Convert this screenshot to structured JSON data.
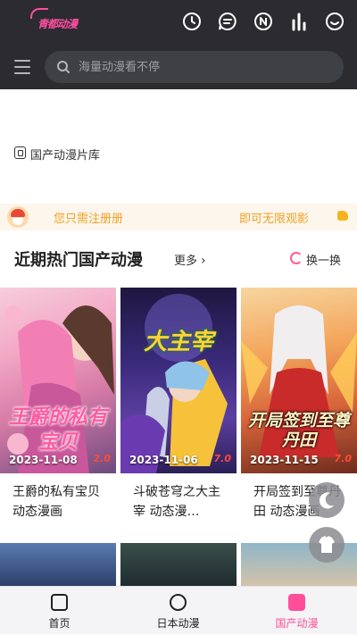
{
  "app": {
    "logo_text": "青都动漫"
  },
  "header": {
    "icons": [
      "clock-icon",
      "chat-icon",
      "notification-n-icon",
      "ranking-bars-icon",
      "smile-icon"
    ]
  },
  "search": {
    "placeholder": "海量动漫看不停"
  },
  "library": {
    "label": "国产动漫片库"
  },
  "register_banner": {
    "left_text": "您只需注册册",
    "right_text": "即可无限观影"
  },
  "section": {
    "title": "近期热门国产动漫",
    "more_label": "更多",
    "refresh_label": "换一换"
  },
  "cards": [
    {
      "title": "王爵的私有宝贝 动态漫画",
      "date": "2023-11-08",
      "badge": "2.0",
      "art_text": "王爵的私有宝贝"
    },
    {
      "title": "斗破苍穹之大主宰 动态漫…",
      "date": "2023-11-06",
      "badge": "7.0",
      "art_text": "大主宰"
    },
    {
      "title": "开局签到至尊丹田 动态漫画",
      "date": "2023-11-15",
      "badge": "7.0",
      "art_text": "开局签到至尊丹田"
    }
  ],
  "nav": {
    "items": [
      {
        "label": "首页",
        "icon": "home-icon"
      },
      {
        "label": "日本动漫",
        "icon": "microphone-icon"
      },
      {
        "label": "国产动漫",
        "icon": "play-icon"
      }
    ],
    "active_index": 2
  },
  "colors": {
    "accent": "#ff4f9a",
    "header_bg": "#2b2b30",
    "banner_text": "#f0a125"
  }
}
